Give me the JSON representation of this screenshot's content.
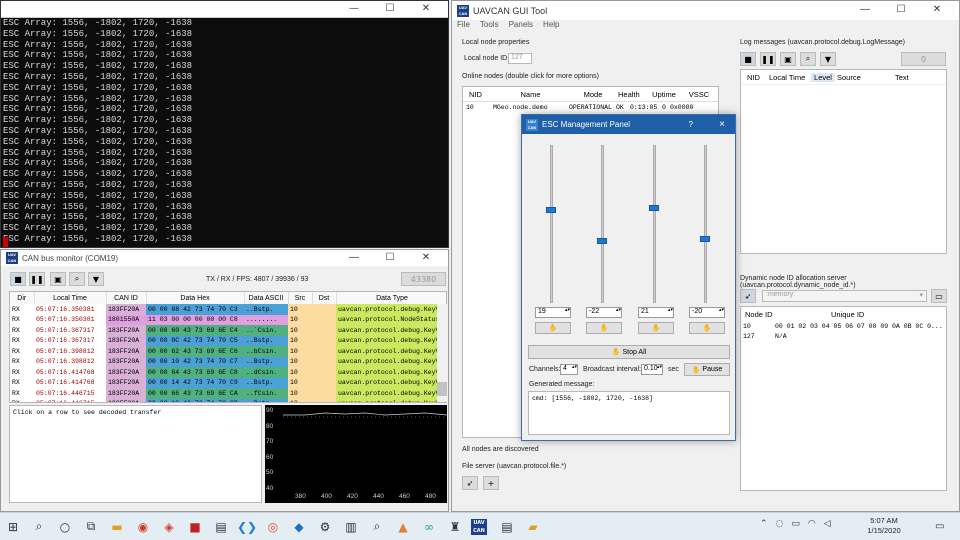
{
  "terminal": {
    "lines": [
      "ESC Array: 1556, -1802, 1720, -1638",
      "ESC Array: 1556, -1802, 1720, -1638",
      "ESC Array: 1556, -1802, 1720, -1638",
      "ESC Array: 1556, -1802, 1720, -1638",
      "ESC Array: 1556, -1802, 1720, -1638",
      "ESC Array: 1556, -1802, 1720, -1638",
      "ESC Array: 1556, -1802, 1720, -1638",
      "ESC Array: 1556, -1802, 1720, -1638",
      "ESC Array: 1556, -1802, 1720, -1638",
      "ESC Array: 1556, -1802, 1720, -1638",
      "ESC Array: 1556, -1802, 1720, -1638",
      "ESC Array: 1556, -1802, 1720, -1638",
      "ESC Array: 1556, -1802, 1720, -1638",
      "ESC Array: 1556, -1802, 1720, -1638",
      "ESC Array: 1556, -1802, 1720, -1638",
      "ESC Array: 1556, -1802, 1720, -1638",
      "ESC Array: 1556, -1802, 1720, -1638",
      "ESC Array: 1556, -1802, 1720, -1638",
      "ESC Array: 1556, -1802, 1720, -1638",
      "ESC Array: 1556, -1802, 1720, -1638",
      "ESC Array: 1556, -1802, 1720, -1638"
    ]
  },
  "gui": {
    "title": "UAVCAN GUI Tool",
    "menu": [
      "File",
      "Tools",
      "Panels",
      "Help"
    ],
    "local_node_props": "Local node properties",
    "local_node_id_label": "Local node ID:",
    "local_node_id": "127",
    "online_nodes_label": "Online nodes (double click for more options)",
    "nodes_headers": [
      "NID",
      "Name",
      "Mode",
      "Health",
      "Uptime",
      "VSSC"
    ],
    "nodes_rows": [
      [
        "10",
        "MGeo.node.demo",
        "OPERATIONAL",
        "OK",
        "0:13:05",
        "0",
        "0x0000"
      ]
    ],
    "all_discovered": "All nodes are discovered",
    "file_server": "File server (uavcan.protocol.file.*)",
    "log_label": "Log messages (uavcan.protocol.debug.LogMessage)",
    "log_count": "0",
    "log_headers": [
      "NID",
      "Local Time",
      "Level",
      "Source",
      "Text"
    ],
    "dyn_label": "Dynamic node ID allocation server (uavcan.protocol.dynamic_node_id.*)",
    "dyn_db": ":memory:",
    "dyn_headers": [
      "Node ID",
      "Unique ID"
    ],
    "dyn_rows": [
      [
        "10",
        "00 01 02 03 04 05 06 07 08 09 0A 0B 0C 0..."
      ],
      [
        "127",
        "N/A"
      ]
    ]
  },
  "esc": {
    "title": "ESC Management Panel",
    "help": "?",
    "close": "×",
    "sliders": [
      19,
      -22,
      21,
      -20
    ],
    "stop_all": "Stop All",
    "channels_label": "Channels:",
    "channels": "4",
    "broadcast_label": "Broadcast interval:",
    "broadcast": "0.10",
    "broadcast_unit": "sec",
    "pause": "Pause",
    "generated_label": "Generated message:",
    "generated": "cmd: [1556, -1802, 1720, -1638]"
  },
  "can": {
    "title": "CAN bus monitor (COM19)",
    "stats_label": "TX / RX / FPS:",
    "stats": "4807 / 39936 / 93",
    "counter": "43380",
    "headers": [
      "Dir",
      "Local Time",
      "CAN ID",
      "Data Hex",
      "Data ASCII",
      "Src",
      "Dst",
      "Data Type"
    ],
    "rows": [
      [
        "RX",
        "05:07:16.350381",
        "183FF20A",
        "00 00 08 42 73 74 70 C3",
        "..Bstp.",
        "10",
        "",
        "uavcan.protocol.debug.KeyV..."
      ],
      [
        "RX",
        "05:07:16.350381",
        "1801550A",
        "11 03 00 00 00 00 00 C8",
        "........",
        "10",
        "",
        "uavcan.protocol.NodeStatus"
      ],
      [
        "RX",
        "05:07:16.367317",
        "183FF20A",
        "00 00 60 43 73 69 6E C4",
        "..`Csin.",
        "10",
        "",
        "uavcan.protocol.debug.KeyV..."
      ],
      [
        "RX",
        "05:07:16.367317",
        "183FF20A",
        "00 00 0C 42 73 74 70 C5",
        "..Bstp.",
        "10",
        "",
        "uavcan.protocol.debug.KeyV..."
      ],
      [
        "RX",
        "05:07:16.398812",
        "183FF20A",
        "00 00 62 43 73 69 6E C6",
        "..bCsin.",
        "10",
        "",
        "uavcan.protocol.debug.KeyV..."
      ],
      [
        "RX",
        "05:07:16.398812",
        "183FF20A",
        "00 00 10 42 73 74 70 C7",
        "..Bstp.",
        "10",
        "",
        "uavcan.protocol.debug.KeyV..."
      ],
      [
        "RX",
        "05:07:16.414768",
        "183FF20A",
        "00 00 64 43 73 69 6E C8",
        "..dCsin.",
        "10",
        "",
        "uavcan.protocol.debug.KeyV..."
      ],
      [
        "RX",
        "05:07:16.414768",
        "183FF20A",
        "00 00 14 42 73 74 70 C9",
        "..Bstp.",
        "10",
        "",
        "uavcan.protocol.debug.KeyV..."
      ],
      [
        "RX",
        "05:07:16.446715",
        "183FF20A",
        "00 00 66 43 73 69 6E CA",
        "..fCsin.",
        "10",
        "",
        "uavcan.protocol.debug.KeyV..."
      ],
      [
        "RX",
        "05:07:16.446715",
        "183FF20A",
        "00 00 18 42 73 74 70 CB",
        "..Bstp.",
        "10",
        "",
        "uavcan.protocol.debug.KeyV..."
      ]
    ],
    "row_colors": [
      "#4ca0d8",
      "#e0a0e0",
      "#50b080",
      "#4ca0d8",
      "#50b080",
      "#4ca0d8",
      "#50b080",
      "#4ca0d8",
      "#50b080",
      "#4ca0d8"
    ],
    "decode_hint": "Click on a row to see decoded transfer",
    "plot_y_ticks": [
      "90",
      "80",
      "70",
      "60",
      "50",
      "40"
    ],
    "plot_x_ticks": [
      "380",
      "400",
      "420",
      "440",
      "460",
      "480"
    ]
  },
  "taskbar": {
    "time": "5:07 AM",
    "date": "1/15/2020"
  }
}
